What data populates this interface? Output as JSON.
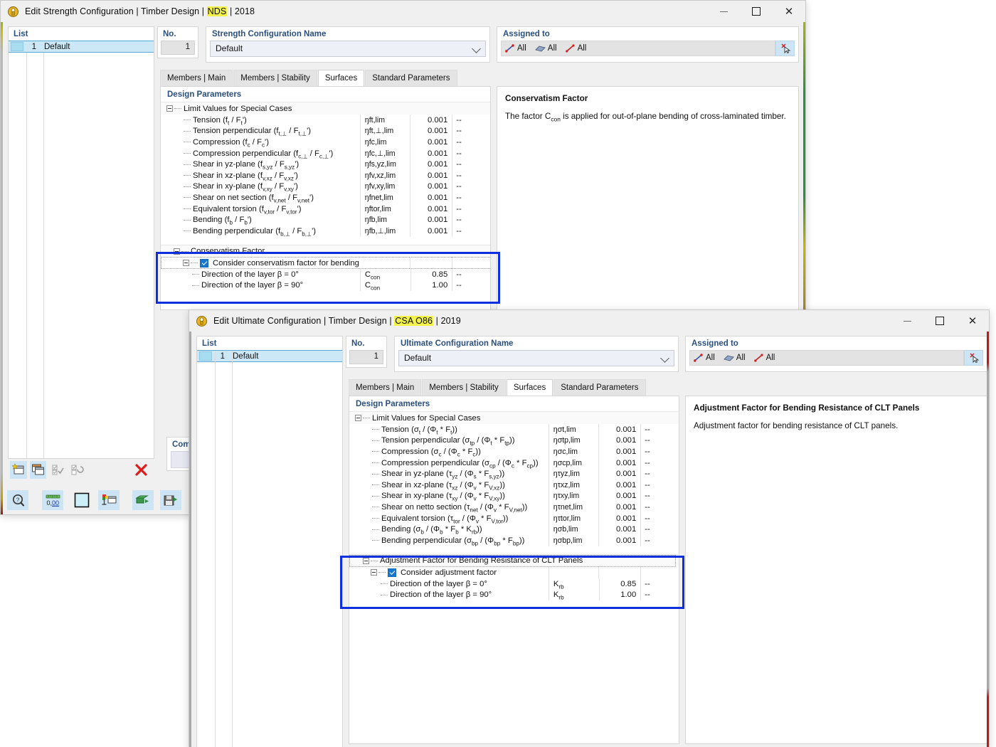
{
  "window1": {
    "title_prefix": "Edit Strength Configuration | Timber Design | ",
    "title_highlight": "NDS",
    "title_suffix": " | 2018",
    "icon": "timber-config-icon",
    "controls": {
      "minimize": "minimize-icon",
      "maximize": "maximize-icon",
      "close": "close-icon"
    },
    "list": {
      "header": "List",
      "rows": [
        {
          "num": "1",
          "name": "Default"
        }
      ]
    },
    "no": {
      "header": "No.",
      "value": "1"
    },
    "config": {
      "header": "Strength Configuration Name",
      "value": "Default",
      "chevron": "chevron-down-icon"
    },
    "assigned": {
      "header": "Assigned to",
      "items": [
        {
          "icon": "member-icon",
          "label": "All"
        },
        {
          "icon": "surface-icon",
          "label": "All"
        },
        {
          "icon": "line-icon",
          "label": "All"
        }
      ],
      "clear_button": "clear-assignment-icon"
    },
    "tabs": [
      {
        "label": "Members | Main",
        "active": false
      },
      {
        "label": "Members | Stability",
        "active": false
      },
      {
        "label": "Surfaces",
        "active": true
      },
      {
        "label": "Standard Parameters",
        "active": false
      }
    ],
    "design_parameters": {
      "header": "Design Parameters",
      "group1": "Limit Values for Special Cases",
      "rows": [
        {
          "label": "Tension (f<sub>t</sub> / F<sub>t</sub>')",
          "symbol": "ŋft,lim",
          "value": "0.001",
          "unit": "--"
        },
        {
          "label": "Tension perpendicular (f<sub>t,⊥</sub> / F<sub>t,⊥</sub>')",
          "symbol": "ŋft,⊥,lim",
          "value": "0.001",
          "unit": "--"
        },
        {
          "label": "Compression (f<sub>c</sub> / F<sub>c</sub>')",
          "symbol": "ŋfc,lim",
          "value": "0.001",
          "unit": "--"
        },
        {
          "label": "Compression perpendicular (f<sub>c,⊥</sub> / F<sub>c,⊥</sub>')",
          "symbol": "ŋfc,⊥,lim",
          "value": "0.001",
          "unit": "--"
        },
        {
          "label": "Shear in yz-plane (f<sub>s,yz</sub> / F<sub>s,yz</sub>')",
          "symbol": "ŋfs,yz,lim",
          "value": "0.001",
          "unit": "--"
        },
        {
          "label": "Shear in xz-plane (f<sub>v,xz</sub> / F<sub>v,xz</sub>')",
          "symbol": "ŋfv,xz,lim",
          "value": "0.001",
          "unit": "--"
        },
        {
          "label": "Shear in xy-plane (f<sub>v,xy</sub> / F<sub>v,xy</sub>')",
          "symbol": "ŋfv,xy,lim",
          "value": "0.001",
          "unit": "--"
        },
        {
          "label": "Shear on net section (f<sub>v,net</sub> / F<sub>v,net</sub>')",
          "symbol": "ŋfnet,lim",
          "value": "0.001",
          "unit": "--"
        },
        {
          "label": "Equivalent torsion (f<sub>v,tor</sub> / F<sub>v,tor</sub>')",
          "symbol": "ŋftor,lim",
          "value": "0.001",
          "unit": "--"
        },
        {
          "label": "Bending (f<sub>b</sub> / F<sub>b</sub>')",
          "symbol": "ŋfb,lim",
          "value": "0.001",
          "unit": "--"
        },
        {
          "label": "Bending perpendicular (f<sub>b,⊥</sub> / F<sub>b,⊥</sub>')",
          "symbol": "ŋfb,⊥,lim",
          "value": "0.001",
          "unit": "--"
        }
      ],
      "group2": "Conservatism Factor",
      "checkbox_label": "Consider conservatism factor for bending",
      "checkbox_checked": true,
      "factor_rows": [
        {
          "label": "Direction of the layer β = 0°",
          "symbol": "C<sub>con</sub>",
          "value": "0.85",
          "unit": "--"
        },
        {
          "label": "Direction of the layer β = 90°",
          "symbol": "C<sub>con</sub>",
          "value": "1.00",
          "unit": "--"
        }
      ]
    },
    "info": {
      "title": "Conservatism Factor",
      "text": "The factor C<sub>con</sub> is applied for out-of-plane bending of cross-laminated timber."
    },
    "comment": {
      "header": "Comment"
    },
    "list_toolbar": [
      {
        "icon": "new-config-icon",
        "enabled": true
      },
      {
        "icon": "copy-config-icon",
        "enabled": true
      },
      {
        "icon": "select-all-icon",
        "enabled": false
      },
      {
        "icon": "deselect-icon",
        "enabled": false
      },
      {
        "icon": "delete-icon",
        "enabled": true
      }
    ],
    "bottom_toolbar": [
      {
        "icon": "help-icon"
      },
      {
        "icon": "units-icon"
      },
      {
        "icon": "color-swatch-icon"
      },
      {
        "icon": "display-properties-icon"
      },
      {
        "icon": "import-icon"
      },
      {
        "icon": "export-icon"
      },
      {
        "icon": "detail-icon"
      },
      {
        "icon": "reset-icon"
      }
    ]
  },
  "window2": {
    "title_prefix": "Edit Ultimate Configuration | Timber Design | ",
    "title_highlight": "CSA O86",
    "title_suffix": " | 2019",
    "icon": "timber-config-icon",
    "controls": {
      "minimize": "minimize-icon",
      "maximize": "maximize-icon",
      "close": "close-icon"
    },
    "list": {
      "header": "List",
      "rows": [
        {
          "num": "1",
          "name": "Default"
        }
      ]
    },
    "no": {
      "header": "No.",
      "value": "1"
    },
    "config": {
      "header": "Ultimate Configuration Name",
      "value": "Default",
      "chevron": "chevron-down-icon"
    },
    "assigned": {
      "header": "Assigned to",
      "items": [
        {
          "icon": "member-icon",
          "label": "All"
        },
        {
          "icon": "surface-icon",
          "label": "All"
        },
        {
          "icon": "line-icon",
          "label": "All"
        }
      ],
      "clear_button": "clear-assignment-icon"
    },
    "tabs": [
      {
        "label": "Members | Main",
        "active": false
      },
      {
        "label": "Members | Stability",
        "active": false
      },
      {
        "label": "Surfaces",
        "active": true
      },
      {
        "label": "Standard Parameters",
        "active": false
      }
    ],
    "design_parameters": {
      "header": "Design Parameters",
      "group1": "Limit Values for Special Cases",
      "rows": [
        {
          "label": "Tension (σ<sub>t</sub> / (Φ<sub>t</sub> * F<sub>t</sub>))",
          "symbol": "ŋσt,lim",
          "value": "0.001",
          "unit": "--"
        },
        {
          "label": "Tension perpendicular (σ<sub>tp</sub> / (Φ<sub>t</sub> * F<sub>tp</sub>))",
          "symbol": "ŋσtp,lim",
          "value": "0.001",
          "unit": "--"
        },
        {
          "label": "Compression (σ<sub>c</sub> / (Φ<sub>c</sub> * F<sub>c</sub>))",
          "symbol": "ŋσc,lim",
          "value": "0.001",
          "unit": "--"
        },
        {
          "label": "Compression perpendicular (σ<sub>cp</sub> / (Φ<sub>c</sub> * F<sub>cp</sub>))",
          "symbol": "ŋσcp,lim",
          "value": "0.001",
          "unit": "--"
        },
        {
          "label": "Shear in yz-plane (τ<sub>yz</sub> / (Φ<sub>s</sub> * F<sub>s,yz</sub>))",
          "symbol": "ŋτyz,lim",
          "value": "0.001",
          "unit": "--"
        },
        {
          "label": "Shear in xz-plane (τ<sub>xz</sub> / (Φ<sub>v</sub> * F<sub>V,xz</sub>))",
          "symbol": "ŋτxz,lim",
          "value": "0.001",
          "unit": "--"
        },
        {
          "label": "Shear in xy-plane (τ<sub>xy</sub> / (Φ<sub>v</sub> * F<sub>V,xy</sub>))",
          "symbol": "ŋτxy,lim",
          "value": "0.001",
          "unit": "--"
        },
        {
          "label": "Shear on netto section (τ<sub>net</sub> / (Φ<sub>v</sub> * F<sub>V,net</sub>))",
          "symbol": "ŋτnet,lim",
          "value": "0.001",
          "unit": "--"
        },
        {
          "label": "Equivalent torsion (τ<sub>tor</sub> / (Φ<sub>v</sub> * F<sub>V,tor</sub>))",
          "symbol": "ŋτtor,lim",
          "value": "0.001",
          "unit": "--"
        },
        {
          "label": "Bending (σ<sub>b</sub> / (Φ<sub>b</sub> * F<sub>b</sub> * K<sub>rb</sub>))",
          "symbol": "ŋσb,lim",
          "value": "0.001",
          "unit": "--"
        },
        {
          "label": "Bending perpendicular (σ<sub>bp</sub> / (Φ<sub>bp</sub> * F<sub>bp</sub>))",
          "symbol": "ŋσbp,lim",
          "value": "0.001",
          "unit": "--"
        }
      ],
      "group2": "Adjustment Factor for Bending Resistance of CLT Panels",
      "checkbox_label": "Consider adjustment factor",
      "checkbox_checked": true,
      "factor_rows": [
        {
          "label": "Direction of the layer β = 0°",
          "symbol": "K<sub>rb</sub>",
          "value": "0.85",
          "unit": "--"
        },
        {
          "label": "Direction of the layer β = 90°",
          "symbol": "K<sub>rb</sub>",
          "value": "1.00",
          "unit": "--"
        }
      ]
    },
    "info": {
      "title": "Adjustment Factor for Bending Resistance of CLT Panels",
      "text": "Adjustment factor for bending resistance of CLT panels."
    }
  },
  "colors": {
    "accent_blue": "#2b4f81",
    "highlight_yellow": "#f2f24a",
    "selection_blue": "#cce8f7",
    "annotation_blue": "#0d2fe0",
    "checkbox_blue": "#1878d0",
    "delete_red": "#e01b1b"
  }
}
